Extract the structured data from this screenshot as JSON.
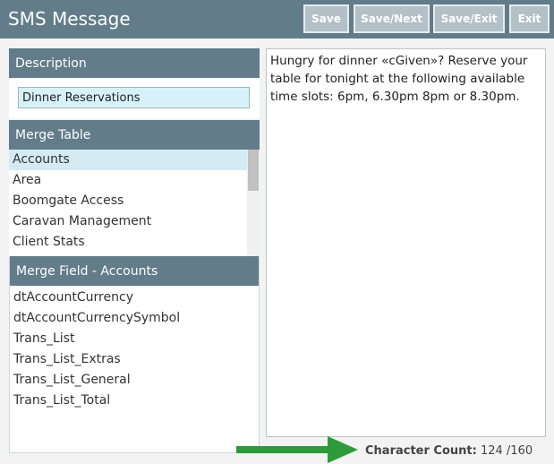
{
  "header": {
    "title": "SMS Message",
    "buttons": {
      "save": "Save",
      "save_next": "Save/Next",
      "save_exit": "Save/Exit",
      "exit": "Exit"
    }
  },
  "description": {
    "header": "Description",
    "value": "Dinner Reservations"
  },
  "merge_table": {
    "header": "Merge Table",
    "items": [
      "Accounts",
      "Area",
      "Boomgate Access",
      "Caravan Management",
      "Client Stats"
    ],
    "selected": "Accounts"
  },
  "merge_field": {
    "header": "Merge Field - Accounts",
    "items": [
      "dtAccountCurrency",
      "dtAccountCurrencySymbol",
      "Trans_List",
      "Trans_List_Extras",
      "Trans_List_General",
      "Trans_List_Total"
    ]
  },
  "message": {
    "text": "Hungry for dinner «cGiven»? Reserve your table for tonight at the following available time slots: 6pm, 6.30pm 8pm or 8.30pm."
  },
  "character_count": {
    "label": "Character Count:",
    "value": "124 /160"
  },
  "colors": {
    "header_bg": "#627c8a",
    "button_bg": "#b3c0c7",
    "selected_row": "#d4ebf4",
    "input_bg": "#d7f1f8",
    "arrow": "#2e9a3a"
  }
}
